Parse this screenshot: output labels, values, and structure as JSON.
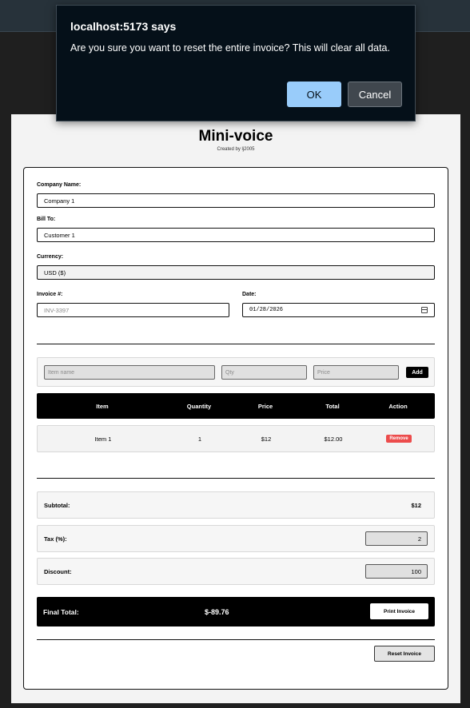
{
  "dialog": {
    "title": "localhost:5173 says",
    "message": "Are you sure you want to reset the entire invoice? This will clear all data.",
    "ok_label": "OK",
    "cancel_label": "Cancel"
  },
  "app": {
    "title": "Mini-voice",
    "subtitle": "Created by lj2005"
  },
  "form": {
    "company_label": "Company Name:",
    "company_value": "Company 1",
    "billto_label": "Bill To:",
    "billto_value": "Customer 1",
    "currency_label": "Currency:",
    "currency_value": "USD ($)",
    "invoice_label": "Invoice #:",
    "invoice_placeholder": "INV-3397",
    "date_label": "Date:",
    "date_value": "01/28/2026"
  },
  "add_item": {
    "name_placeholder": "Item name",
    "qty_placeholder": "Qty",
    "price_placeholder": "Price",
    "add_label": "Add"
  },
  "table": {
    "headers": [
      "Item",
      "Quantity",
      "Price",
      "Total",
      "Action"
    ],
    "rows": [
      {
        "item": "Item 1",
        "quantity": "1",
        "price": "$12",
        "total": "$12.00",
        "action": "Remove"
      }
    ]
  },
  "summary": {
    "subtotal_label": "Subtotal:",
    "subtotal_value": "$12",
    "tax_label": "Tax (%):",
    "tax_value": "2",
    "discount_label": "Discount:",
    "discount_value": "100",
    "final_label": "Final Total:",
    "final_value": "$-89.76",
    "print_label": "Print Invoice",
    "reset_label": "Reset Invoice"
  },
  "icons": {
    "date_picker": "calendar-icon"
  },
  "colors": {
    "dialog_bg": "#051019",
    "ok_button": "#99ccfa",
    "remove_button": "#ec4c4c"
  }
}
